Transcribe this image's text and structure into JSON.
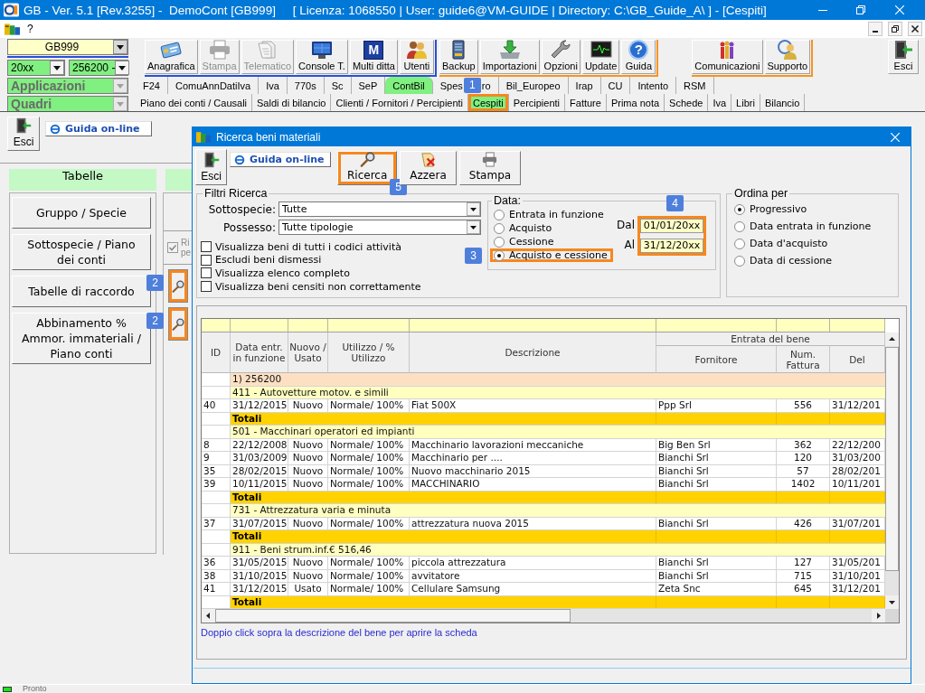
{
  "window": {
    "title": "GB - Ver. 5.1 [Rev.3255] -  DemoCont [GB999]     [ Licenza: 1068550 | User: guide6@VM-GUIDE | Directory: C:\\GB_Guide_A\\ ] - [Cespiti]"
  },
  "menu_bar": {
    "items": [
      "?"
    ]
  },
  "selectors": {
    "company": "GB999",
    "year": "20xx",
    "account": "256200 -",
    "applications": "Applicazioni",
    "sections": "Quadri"
  },
  "toolbar": {
    "groups": [
      {
        "color": "#2850d8",
        "buttons": [
          {
            "label": "Anagrafica",
            "disabled": false
          },
          {
            "label": "Stampa",
            "disabled": true
          },
          {
            "label": "Telematico",
            "disabled": true
          },
          {
            "label": "Console T.",
            "disabled": false
          },
          {
            "label": "Multi ditta",
            "disabled": false,
            "icon_text": "M"
          },
          {
            "label": "Utenti",
            "disabled": false
          }
        ]
      },
      {
        "color": "#f7931e",
        "buttons": [
          {
            "label": "Backup",
            "disabled": false
          },
          {
            "label": "Importazioni",
            "disabled": false
          },
          {
            "label": "Opzioni",
            "disabled": false
          },
          {
            "label": "Update",
            "disabled": false
          },
          {
            "label": "Guida",
            "disabled": false,
            "icon_text": "?"
          }
        ]
      },
      {
        "color": "#f7931e",
        "buttons": [
          {
            "label": "Comunicazioni",
            "disabled": false
          },
          {
            "label": "Supporto",
            "disabled": false
          }
        ]
      }
    ],
    "exit": "Esci"
  },
  "app_tabs": [
    {
      "label": "F24",
      "selected": false
    },
    {
      "label": "ComuAnnDatiIva",
      "selected": false
    },
    {
      "label": "Iva",
      "selected": false
    },
    {
      "label": "770s",
      "selected": false
    },
    {
      "label": "Sc",
      "selected": false
    },
    {
      "label": "SeP",
      "selected": false
    },
    {
      "label": "ContBil",
      "selected": true
    },
    {
      "label": "Spes",
      "badge": "1",
      "label_end": "ro",
      "selected": false
    },
    {
      "label": "Bil_Europeo",
      "selected": false
    },
    {
      "label": "Irap",
      "selected": false
    },
    {
      "label": "CU",
      "selected": false
    },
    {
      "label": "Intento",
      "selected": false
    },
    {
      "label": "RSM",
      "selected": false
    }
  ],
  "section_tabs": [
    {
      "label": "Piano dei conti / Causali",
      "selected": false,
      "highlighted": false
    },
    {
      "label": "Saldi di bilancio",
      "selected": false,
      "highlighted": false
    },
    {
      "label": "Clienti / Fornitori / Percipienti",
      "selected": false,
      "highlighted": false
    },
    {
      "label": "Cespiti",
      "selected": true,
      "highlighted": true
    },
    {
      "label": "Percipienti",
      "selected": false,
      "highlighted": false
    },
    {
      "label": "Fatture",
      "selected": false,
      "highlighted": false
    },
    {
      "label": "Prima nota",
      "selected": false,
      "highlighted": false
    },
    {
      "label": "Schede",
      "selected": false,
      "highlighted": false
    },
    {
      "label": "Iva",
      "selected": false,
      "highlighted": false
    },
    {
      "label": "Libri",
      "selected": false,
      "highlighted": false
    },
    {
      "label": "Bilancio",
      "selected": false,
      "highlighted": false
    }
  ],
  "side_panel": {
    "exit": "Esci",
    "help": "Guida on-line",
    "title": "Tabelle",
    "buttons": [
      "Gruppo / Specie",
      "Sottospecie / Piano dei conti",
      "Tabelle di raccordo",
      "Abbinamento % Ammor. immateriali / Piano conti"
    ]
  },
  "side_column": {
    "checkbox": {
      "label": "Ri pe",
      "checked": true,
      "disabled": true
    },
    "search_buttons": [
      {
        "highlighted": true,
        "badge": "2"
      },
      {
        "highlighted": true,
        "badge": "2"
      }
    ]
  },
  "dialog": {
    "title": "Ricerca beni materiali",
    "toolbar": [
      {
        "kind": "exit",
        "label": "Esci",
        "highlighted": false
      },
      {
        "kind": "link",
        "label": "Guida on-line",
        "highlighted": false
      },
      {
        "kind": "tool",
        "label": "Ricerca",
        "highlighted": true,
        "badge": "5"
      },
      {
        "kind": "tool",
        "label": "Azzera",
        "highlighted": false
      },
      {
        "kind": "tool",
        "label": "Stampa",
        "highlighted": false
      }
    ],
    "filters": {
      "title": "Filtri Ricerca",
      "fields": [
        {
          "label": "Sottospecie:",
          "value": "Tutte"
        },
        {
          "label": "Possesso:",
          "value": "Tutte tipologie"
        }
      ],
      "checkboxes": [
        {
          "label": "Visualizza beni di tutti i codici attività",
          "checked": false
        },
        {
          "label": "Escludi beni dismessi",
          "checked": false
        },
        {
          "label": "Visualizza elenco completo",
          "checked": false
        },
        {
          "label": "Visualizza beni censiti non correttamente",
          "checked": false
        }
      ]
    },
    "date_filter": {
      "title": "Data:",
      "options": [
        {
          "label": "Entrata in funzione",
          "selected": false,
          "highlighted": false
        },
        {
          "label": "Acquisto",
          "selected": false,
          "highlighted": false
        },
        {
          "label": "Cessione",
          "selected": false,
          "highlighted": false
        },
        {
          "label": "Acquisto e cessione",
          "selected": true,
          "highlighted": true,
          "badge": "3"
        }
      ],
      "range": {
        "highlighted": true,
        "badge": "4",
        "from": {
          "label": "Dal",
          "value": "01/01/20xx"
        },
        "to": {
          "label": "Al",
          "value": "31/12/20xx"
        }
      }
    },
    "sort": {
      "title": "Ordina per",
      "options": [
        {
          "label": "Progressivo",
          "selected": true
        },
        {
          "label": "Data entrata in funzione",
          "selected": false
        },
        {
          "label": "Data d'acquisto",
          "selected": false
        },
        {
          "label": "Data di cessione",
          "selected": false
        }
      ]
    },
    "table": {
      "columns": [
        "ID",
        "Data entr. in funzione",
        "Nuovo / Usato",
        "Utilizzo / % Utilizzo",
        "Descrizione",
        "Fornitore",
        "Num. Fattura",
        "Del"
      ],
      "column_group": "Entrata del bene",
      "rows": [
        {
          "kind": "group",
          "label": "1) 256200"
        },
        {
          "kind": "category",
          "label": "411 - Autovetture motov. e simili"
        },
        {
          "kind": "item",
          "cells": [
            "40",
            "31/12/2015",
            "Nuovo",
            "Normale/ 100%",
            "Fiat 500X",
            "Ppp Srl",
            "556",
            "31/12/201"
          ]
        },
        {
          "kind": "total",
          "label": "Totali"
        },
        {
          "kind": "category",
          "label": "501 - Macchinari operatori ed impianti"
        },
        {
          "kind": "item",
          "cells": [
            "8",
            "22/12/2008",
            "Nuovo",
            "Normale/ 100%",
            "Macchinario lavorazioni meccaniche",
            "Big Ben Srl",
            "362",
            "22/12/200"
          ]
        },
        {
          "kind": "item",
          "cells": [
            "9",
            "31/03/2009",
            "Nuovo",
            "Normale/ 100%",
            "Macchinario per ....",
            "Bianchi Srl",
            "120",
            "31/03/200"
          ]
        },
        {
          "kind": "item",
          "cells": [
            "35",
            "28/02/2015",
            "Nuovo",
            "Normale/ 100%",
            "Nuovo macchinario 2015",
            "Bianchi Srl",
            "57",
            "28/02/201"
          ]
        },
        {
          "kind": "item",
          "cells": [
            "39",
            "10/11/2015",
            "Nuovo",
            "Normale/ 100%",
            "MACCHINARIO",
            "Bianchi Srl",
            "1402",
            "10/11/201"
          ]
        },
        {
          "kind": "total",
          "label": "Totali"
        },
        {
          "kind": "category",
          "label": "731 - Attrezzatura varia e minuta"
        },
        {
          "kind": "item",
          "cells": [
            "37",
            "31/07/2015",
            "Nuovo",
            "Normale/ 100%",
            "attrezzatura nuova 2015",
            "Bianchi Srl",
            "426",
            "31/07/201"
          ]
        },
        {
          "kind": "total",
          "label": "Totali"
        },
        {
          "kind": "category",
          "label": "911 - Beni strum.inf.€ 516,46"
        },
        {
          "kind": "item",
          "cells": [
            "36",
            "31/05/2015",
            "Nuovo",
            "Normale/ 100%",
            "piccola attrezzatura",
            "Bianchi Srl",
            "127",
            "31/05/201"
          ]
        },
        {
          "kind": "item",
          "cells": [
            "38",
            "31/10/2015",
            "Nuovo",
            "Normale/ 100%",
            "avvitatore",
            "Bianchi Srl",
            "715",
            "31/10/201"
          ]
        },
        {
          "kind": "item",
          "cells": [
            "41",
            "31/12/2015",
            "Usato",
            "Normale/ 100%",
            "Cellulare Samsung",
            "Zeta Snc",
            "645",
            "31/12/201"
          ]
        },
        {
          "kind": "total",
          "label": "Totali"
        }
      ]
    },
    "hint": "Doppio click sopra la descrizione del bene per aprire la scheda"
  },
  "status_bar": {
    "text": "Pronto"
  }
}
